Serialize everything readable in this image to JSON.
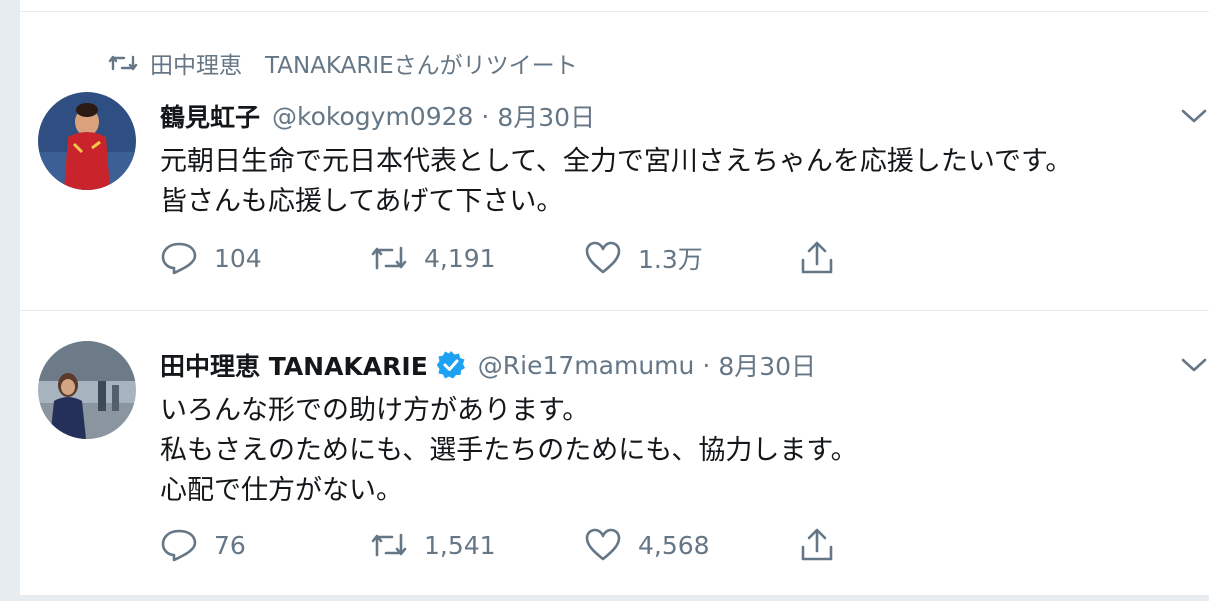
{
  "tweets": [
    {
      "retweet_context": "田中理恵　TANAKARIEさんがリツイート",
      "display_name": "鶴見虹子",
      "handle": "@kokogym0928",
      "separator": "·",
      "time": "8月30日",
      "verified": false,
      "text_lines": [
        "元朝日生命で元日本代表として、全力で宮川さえちゃんを応援したいです。",
        "皆さんも応援してあげて下さい。"
      ],
      "replies": "104",
      "retweets": "4,191",
      "likes": "1.3万"
    },
    {
      "display_name": "田中理恵 TANAKARIE",
      "handle": "@Rie17mamumu",
      "separator": "·",
      "time": "8月30日",
      "verified": true,
      "text_lines": [
        "いろんな形での助け方があります。",
        "私もさえのためにも、選手たちのためにも、協力します。",
        "心配で仕方がない。"
      ],
      "replies": "76",
      "retweets": "1,541",
      "likes": "4,568"
    }
  ],
  "icons": {
    "retweet_context": "retweet-icon",
    "caret": "chevron-down-icon",
    "reply": "reply-icon",
    "retweet": "retweet-icon",
    "like": "heart-icon",
    "share": "share-icon",
    "verified": "verified-badge-icon"
  },
  "colors": {
    "background": "#e6ecf0",
    "card": "#ffffff",
    "primary_text": "#14171a",
    "secondary_text": "#657786",
    "verified_blue": "#1da1f2"
  }
}
